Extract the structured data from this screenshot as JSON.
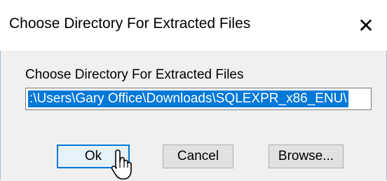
{
  "window": {
    "title": "Choose Directory For Extracted Files",
    "close_glyph": "✕"
  },
  "form": {
    "prompt": "Choose Directory For Extracted Files",
    "path_value": ":\\Users\\Gary Office\\Downloads\\SQLEXPR_x86_ENU\\"
  },
  "buttons": {
    "ok": "Ok",
    "cancel": "Cancel",
    "browse": "Browse..."
  },
  "colors": {
    "selection": "#0078d7",
    "default_button_border": "#0078d7",
    "window_background": "#f0f0f0"
  },
  "icons": {
    "cursor": "hand-pointer-icon",
    "close": "close-icon"
  }
}
